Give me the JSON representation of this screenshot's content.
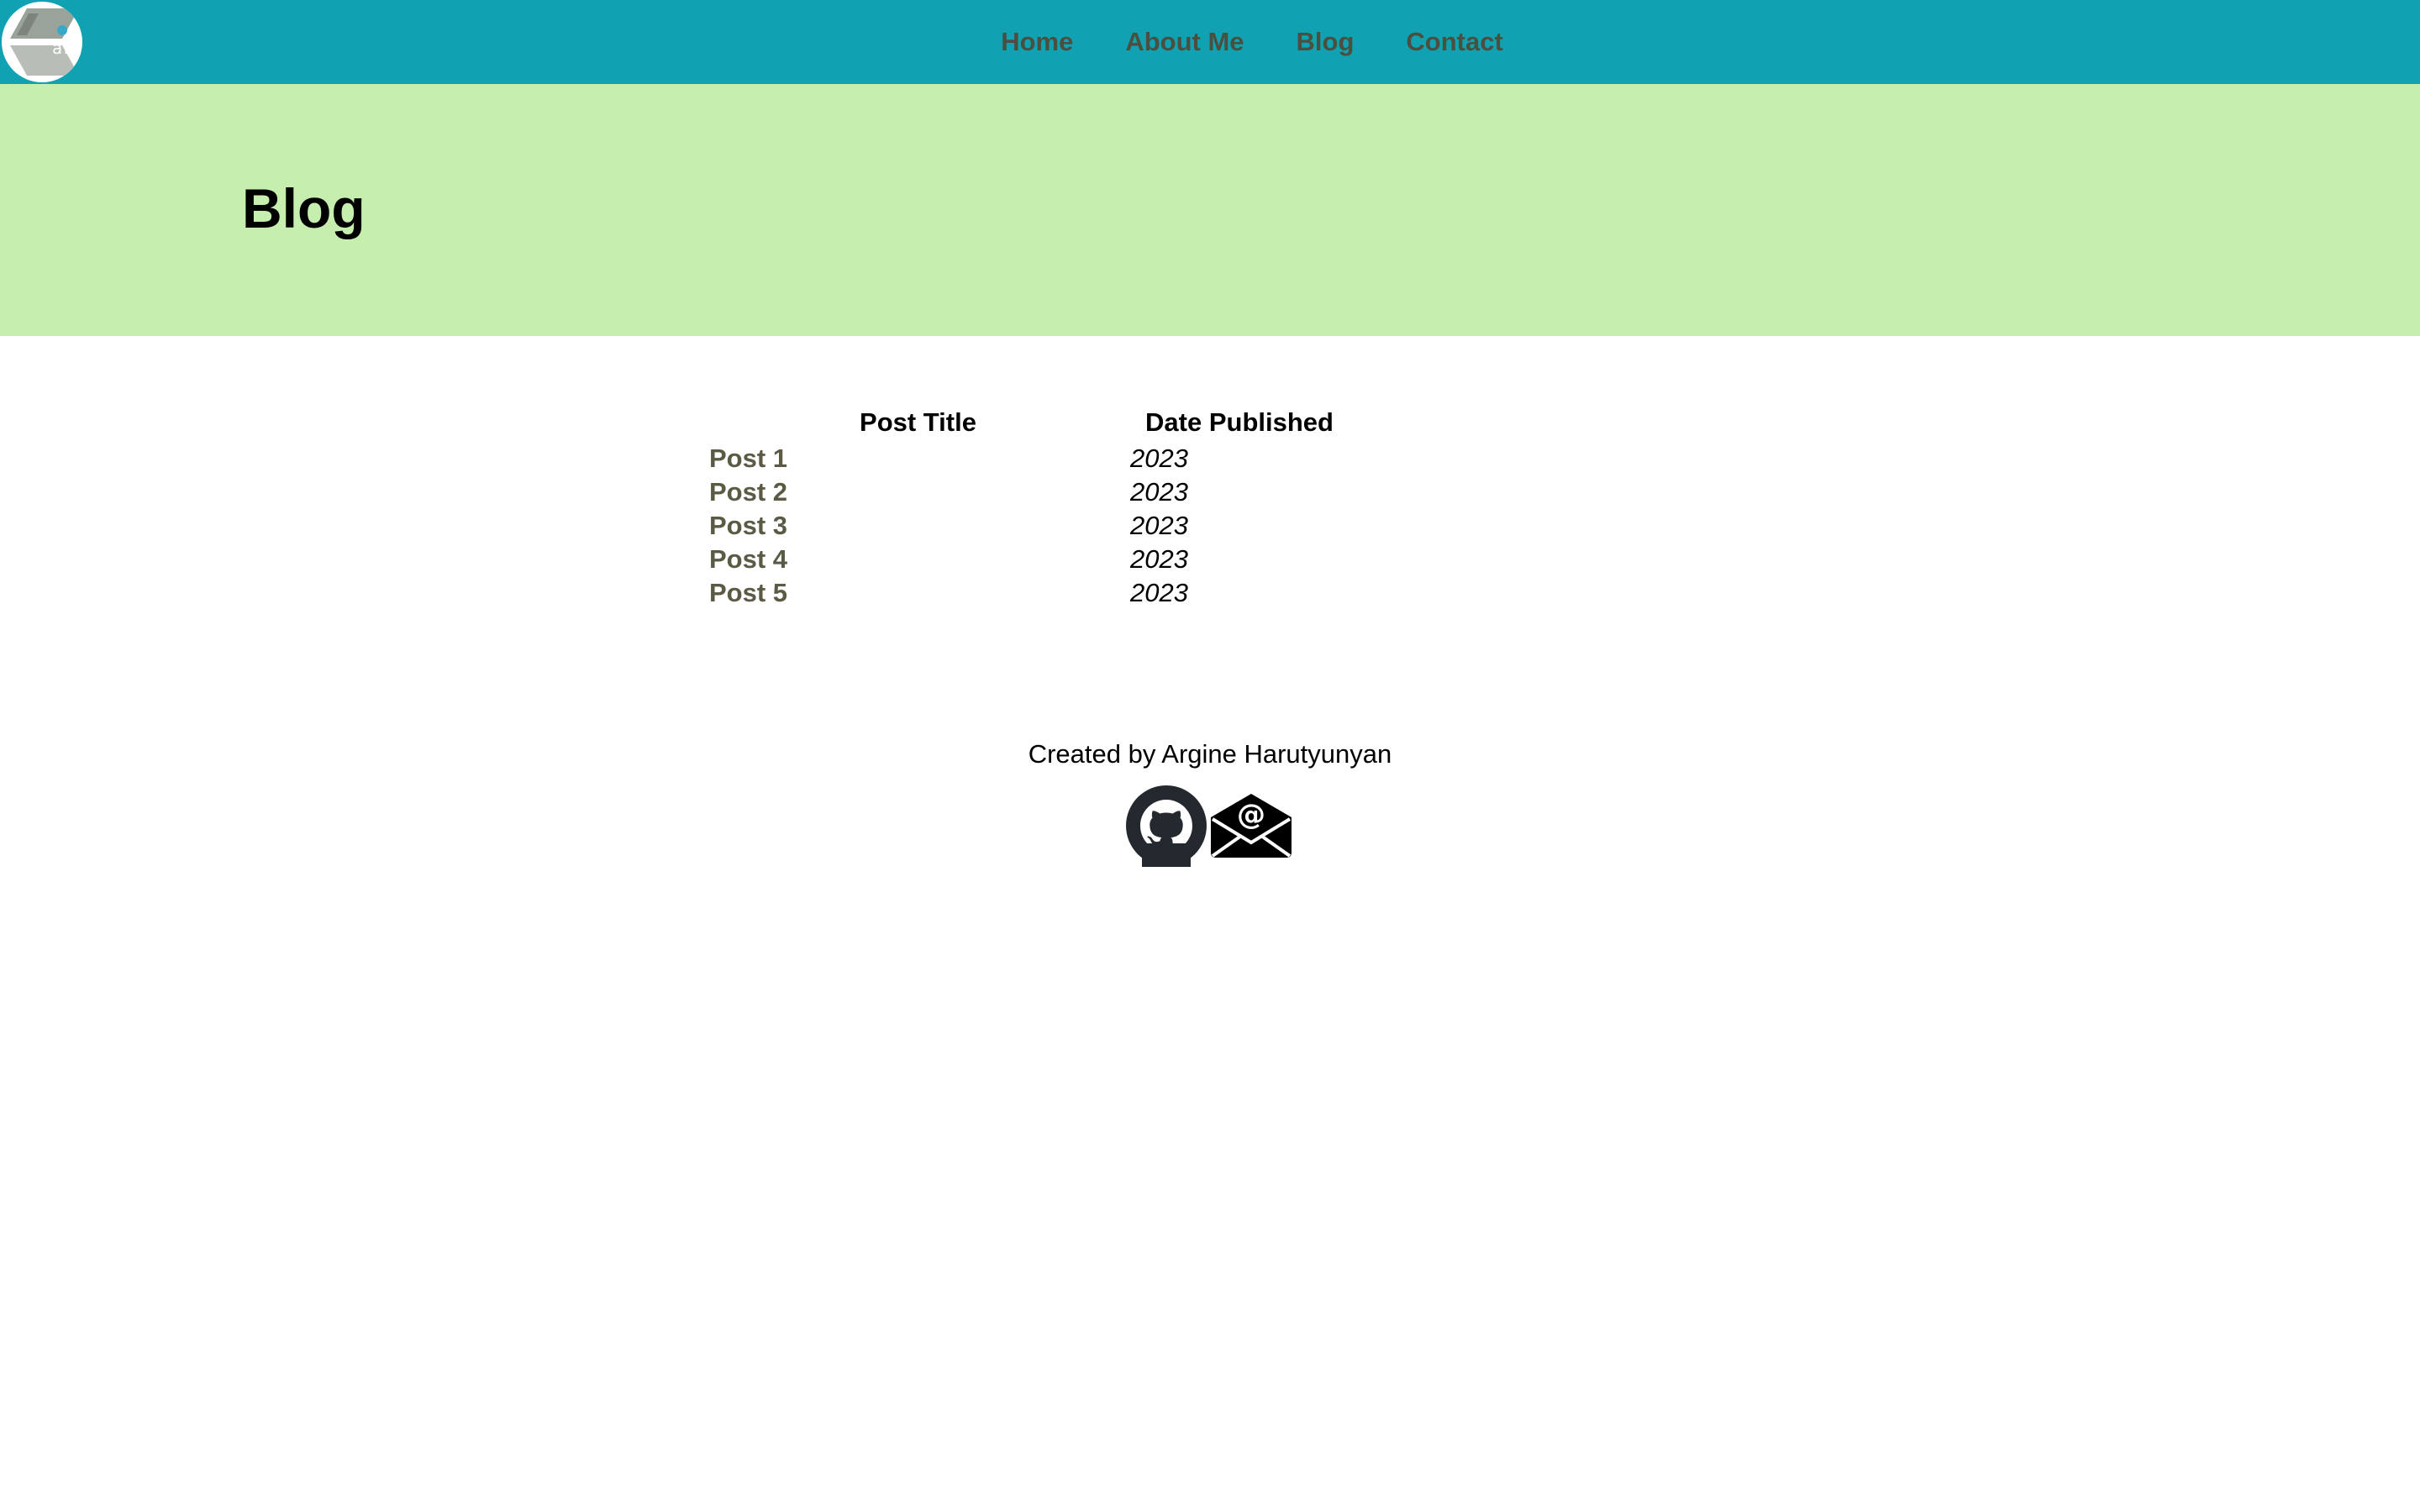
{
  "header": {
    "logo_alt": "arg",
    "nav": [
      "Home",
      "About Me",
      "Blog",
      "Contact"
    ]
  },
  "hero": {
    "title": "Blog"
  },
  "table": {
    "headers": [
      "Post Title",
      "Date Published"
    ],
    "rows": [
      {
        "title": "Post 1",
        "date": "2023"
      },
      {
        "title": "Post 2",
        "date": "2023"
      },
      {
        "title": "Post 3",
        "date": "2023"
      },
      {
        "title": "Post 4",
        "date": "2023"
      },
      {
        "title": "Post 5",
        "date": "2023"
      }
    ]
  },
  "footer": {
    "credit": "Created by Argine Harutyunyan",
    "icons": [
      "github-icon",
      "email-icon"
    ]
  },
  "colors": {
    "navbar": "#10a2b2",
    "hero": "#c6efaf",
    "nav_text": "#4a4f40",
    "post_link": "#5b5a45"
  }
}
